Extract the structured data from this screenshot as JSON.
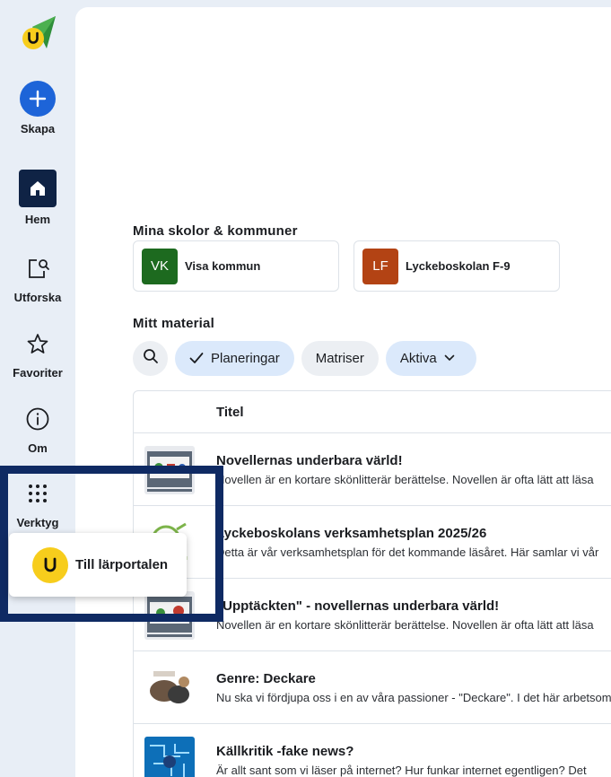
{
  "sidebar": {
    "create_label": "Skapa",
    "items": [
      {
        "label": "Hem",
        "icon": "home-icon"
      },
      {
        "label": "Utforska",
        "icon": "explore-icon"
      },
      {
        "label": "Favoriter",
        "icon": "star-icon"
      },
      {
        "label": "Om",
        "icon": "info-icon"
      },
      {
        "label": "Verktyg",
        "icon": "grid-dots-icon"
      }
    ]
  },
  "schools": {
    "title": "Mina skolor & kommuner",
    "cards": [
      {
        "initials": "VK",
        "name": "Visa kommun",
        "color": "#1d6a1f"
      },
      {
        "initials": "LF",
        "name": "Lyckeboskolan F-9",
        "color": "#b34314"
      }
    ]
  },
  "material": {
    "title": "Mitt material",
    "filters": {
      "planeringar": "Planeringar",
      "matriser": "Matriser",
      "aktiva": "Aktiva"
    },
    "column_title": "Titel",
    "rows": [
      {
        "title": "Novellernas underbara värld!",
        "desc": "Novellen är en kortare skönlitterär berättelse. Novellen är ofta lätt att läsa"
      },
      {
        "title": "Lyckeboskolans verksamhetsplan 2025/26",
        "desc": "Detta är vår verksamhetsplan för det kommande läsåret. Här samlar vi vår"
      },
      {
        "title": "\"Upptäckten\" - novellernas underbara värld!",
        "desc": "Novellen är en kortare skönlitterär berättelse. Novellen är ofta lätt att läsa"
      },
      {
        "title": "Genre: Deckare",
        "desc": "Nu ska vi fördjupa oss i en av våra passioner - \"Deckare\". I det här arbetsområdet"
      },
      {
        "title": "Källkritik -fake news?",
        "desc": "Är allt sant som vi läser på internet? Hur funkar internet egentligen? Det"
      }
    ]
  },
  "popup": {
    "label": "Till lärportalen"
  },
  "colors": {
    "accent": "#1d64d8",
    "nav_dark": "#0f2345",
    "highlight": "#0f2a63",
    "chip_active": "#dbe9fb",
    "brand_yellow": "#f7cd1c"
  }
}
